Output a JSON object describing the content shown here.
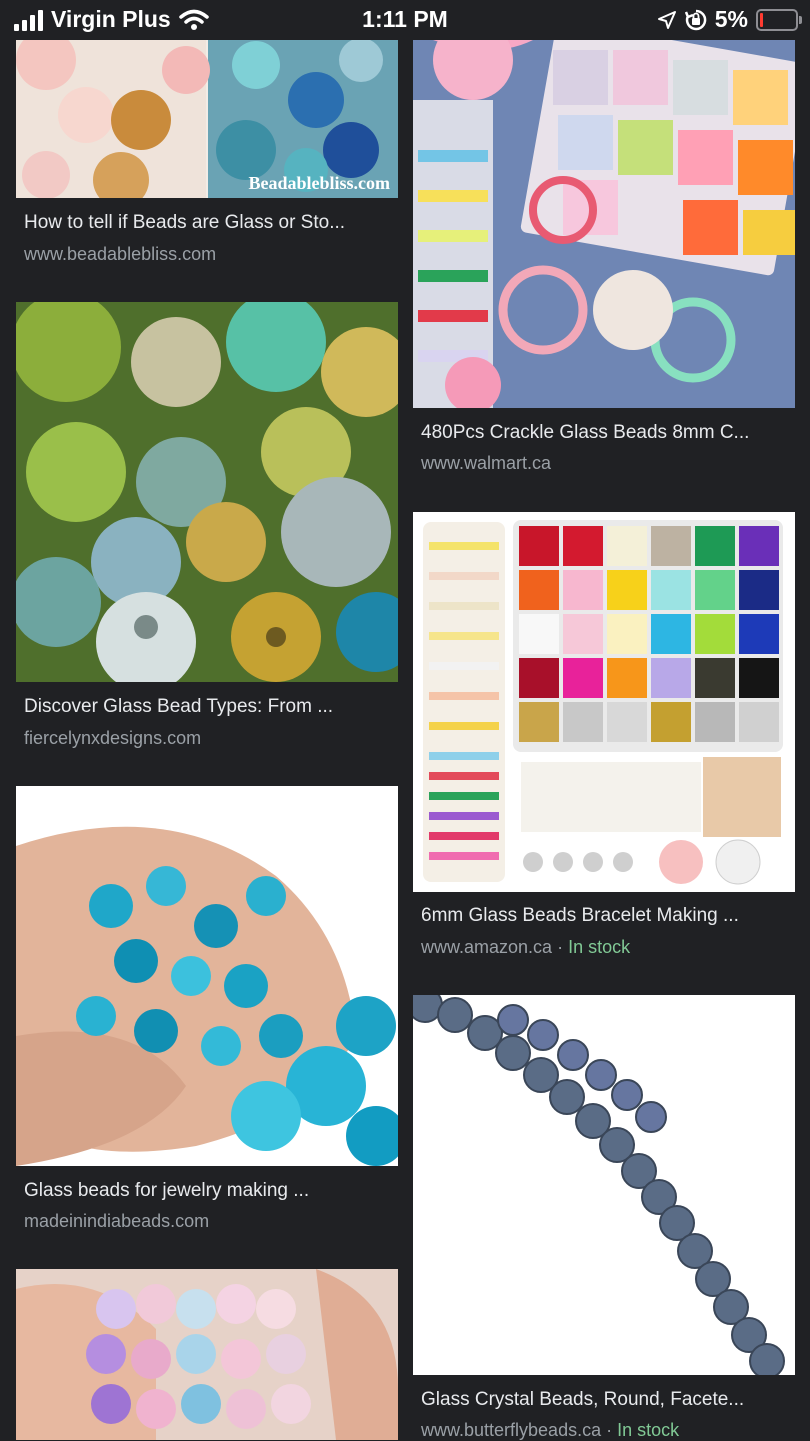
{
  "status_bar": {
    "carrier": "Virgin Plus",
    "time": "1:11 PM",
    "battery_percent": "5%",
    "battery_level": 0.05,
    "icons": [
      "signal-icon",
      "wifi-icon",
      "location-icon",
      "rotation-lock-icon",
      "battery-icon"
    ]
  },
  "results": [
    {
      "title": "How to tell if Beads are Glass or Sto...",
      "site": "www.beadablebliss.com",
      "image_text": "Beadablebliss.com"
    },
    {
      "title": "480Pcs Crackle Glass Beads 8mm C...",
      "site": "www.walmart.ca"
    },
    {
      "title": "Discover Glass Bead Types: From ...",
      "site": "fiercelynxdesigns.com"
    },
    {
      "title": "6mm Glass Beads Bracelet Making ...",
      "site": "www.amazon.ca",
      "separator": " · ",
      "stock": "In stock"
    },
    {
      "title": "Glass beads for jewelry making ...",
      "site": "madeinindiabeads.com"
    },
    {
      "title": "Glass Crystal Beads, Round, Facete...",
      "site": "www.butterflybeads.ca",
      "separator": " · ",
      "stock": "In stock"
    }
  ],
  "colors": {
    "background": "#202124",
    "title": "#e8eaed",
    "site": "#9aa0a6",
    "stock": "#81c995"
  }
}
